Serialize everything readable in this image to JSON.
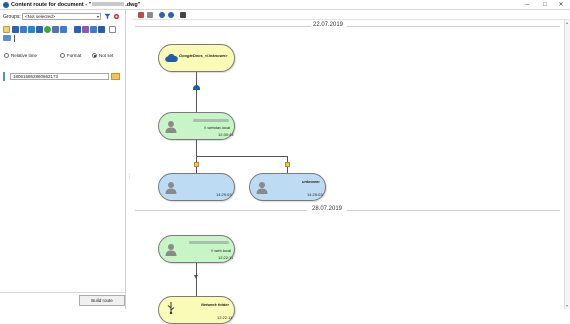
{
  "window": {
    "title_prefix": "Content route for document - \"",
    "title_suffix": ".dwg\"",
    "min_glyph": "─",
    "max_glyph": "□",
    "close_glyph": "✕"
  },
  "left_panel": {
    "groups_label": "Groups:",
    "groups_value": "<Not selected>",
    "groups_arrow": "▾",
    "radios": [
      {
        "label": "Relative time",
        "selected": false
      },
      {
        "label": "Format",
        "selected": false
      },
      {
        "label": "Not set",
        "selected": true
      }
    ],
    "id_value": "180615862860862173",
    "build_button": "Build route",
    "splitter_glyph": "⋮"
  },
  "icons": {
    "toolbar": [
      "filter-icon",
      "gear-icon"
    ],
    "row1": [
      "users-icon",
      "copy-icon",
      "link-icon",
      "refresh-icon",
      "share-icon",
      "phone-icon",
      "list-icon",
      "chart-icon",
      "cloud-icon",
      "folder-icon",
      "hierarchy-icon",
      "cloud-icon",
      "usb-icon",
      "tree-icon"
    ],
    "right_toolbar": [
      "print-icon",
      "printer-icon",
      "zoom-in-icon",
      "zoom-out-icon",
      "binoculars-icon"
    ]
  },
  "colors": {
    "yellow_node": "#fbfbb8",
    "green_node": "#c7f5c5",
    "blue_node": "#bddcf4",
    "accent_blue": "#4a8fd8"
  },
  "timeline": {
    "date1": "22.07.2019",
    "date2": "28.07.2019",
    "nodes": {
      "n1": {
        "label": "GoogleDocs_<Unknown>"
      },
      "n2": {
        "label_blurred": true,
        "sub": "\\\\ webdav.local",
        "time": "12:30:44"
      },
      "n3": {
        "time": "14:29:03"
      },
      "n4": {
        "label": "unknown",
        "time": "14:29:03"
      },
      "n5": {
        "sub": "\\\\ web.local",
        "time": "12:22:11"
      },
      "n6": {
        "label": "Network folder",
        "time": "12:22:11"
      }
    }
  }
}
